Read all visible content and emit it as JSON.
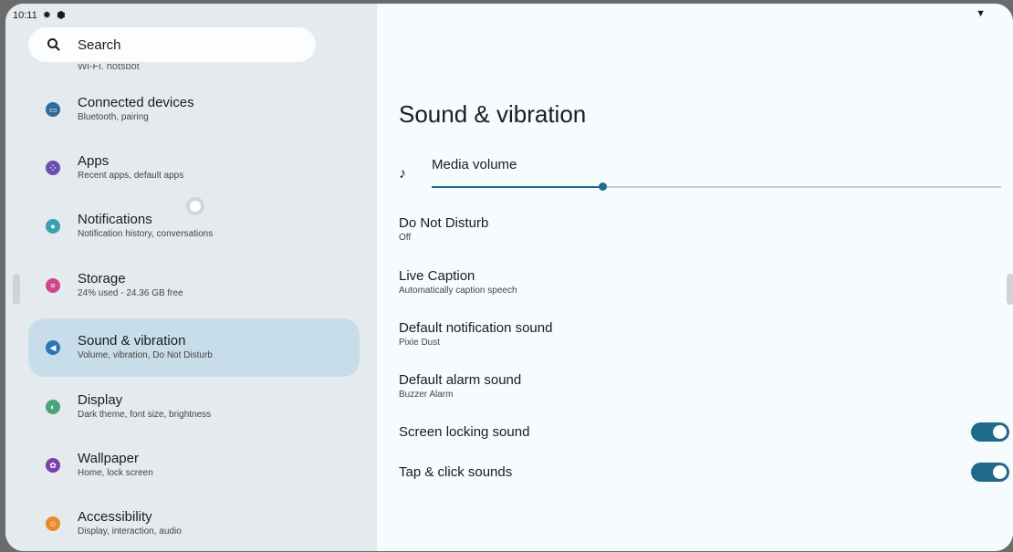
{
  "status_bar": {
    "time": "10:11",
    "icons": [
      "gear-icon",
      "shield-icon",
      "wifi-icon"
    ]
  },
  "sidebar": {
    "search_placeholder": "Search",
    "partial_item_sub": "Wi-Fi, hotspot",
    "items": [
      {
        "title": "Connected devices",
        "subtitle": "Bluetooth, pairing",
        "icon": "devices-icon",
        "color": "#2f6b9a"
      },
      {
        "title": "Apps",
        "subtitle": "Recent apps, default apps",
        "icon": "apps-icon",
        "color": "#6a4fb0"
      },
      {
        "title": "Notifications",
        "subtitle": "Notification history, conversations",
        "icon": "bell-icon",
        "color": "#3a9fb0"
      },
      {
        "title": "Storage",
        "subtitle": "24% used - 24.36 GB free",
        "icon": "storage-icon",
        "color": "#d0458b"
      },
      {
        "title": "Sound & vibration",
        "subtitle": "Volume, vibration, Do Not Disturb",
        "icon": "volume-icon",
        "color": "#2e74b5",
        "selected": true
      },
      {
        "title": "Display",
        "subtitle": "Dark theme, font size, brightness",
        "icon": "display-icon",
        "color": "#4aa47a"
      },
      {
        "title": "Wallpaper",
        "subtitle": "Home, lock screen",
        "icon": "palette-icon",
        "color": "#7b3fa8"
      },
      {
        "title": "Accessibility",
        "subtitle": "Display, interaction, audio",
        "icon": "accessibility-icon",
        "color": "#e88a2a"
      }
    ]
  },
  "main": {
    "title": "Sound & vibration",
    "media_volume": {
      "label": "Media volume",
      "level": 0.3
    },
    "prefs": [
      {
        "title": "Do Not Disturb",
        "subtitle": "Off"
      },
      {
        "title": "Live Caption",
        "subtitle": "Automatically caption speech"
      },
      {
        "title": "Default notification sound",
        "subtitle": "Pixie Dust"
      },
      {
        "title": "Default alarm sound",
        "subtitle": "Buzzer Alarm"
      },
      {
        "title": "Screen locking sound",
        "toggle": true
      },
      {
        "title": "Tap & click sounds",
        "toggle": true
      }
    ]
  }
}
